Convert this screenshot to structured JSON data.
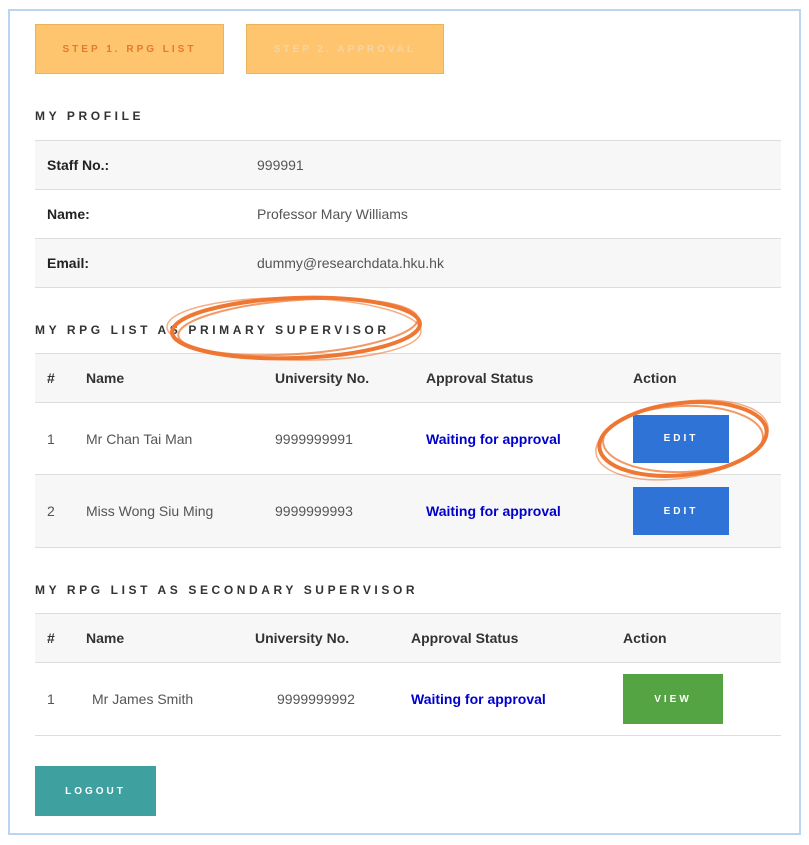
{
  "steps": [
    {
      "label": "STEP 1. RPG LIST"
    },
    {
      "label": "STEP 2. APPROVAL"
    }
  ],
  "profile": {
    "title": "MY PROFILE",
    "rows": [
      {
        "label": "Staff No.:",
        "value": "999991"
      },
      {
        "label": "Name:",
        "value": "Professor Mary Williams"
      },
      {
        "label": "Email:",
        "value": "dummy@researchdata.hku.hk"
      }
    ]
  },
  "primary": {
    "title": "MY RPG LIST AS PRIMARY SUPERVISOR",
    "headers": [
      "#",
      "Name",
      "University No.",
      "Approval Status",
      "Action"
    ],
    "rows": [
      {
        "num": "1",
        "name": "Mr Chan Tai Man",
        "uni_no": "9999999991",
        "status": "Waiting for approval",
        "action": "EDIT"
      },
      {
        "num": "2",
        "name": "Miss Wong Siu Ming",
        "uni_no": "9999999993",
        "status": "Waiting for approval",
        "action": "EDIT"
      }
    ]
  },
  "secondary": {
    "title": "MY RPG LIST AS SECONDARY SUPERVISOR",
    "headers": [
      "#",
      "Name",
      "University No.",
      "Approval Status",
      "Action"
    ],
    "rows": [
      {
        "num": "1",
        "name": "Mr James Smith",
        "uni_no": "9999999992",
        "status": "Waiting for approval",
        "action": "VIEW"
      }
    ]
  },
  "logout_label": "LOGOUT",
  "colors": {
    "step_button": "#ffc46e",
    "edit_button": "#2f73d6",
    "view_button": "#55a444",
    "logout_button": "#3fa0a0",
    "status_text": "#0000cc",
    "annotation_circle": "#ee7733"
  }
}
